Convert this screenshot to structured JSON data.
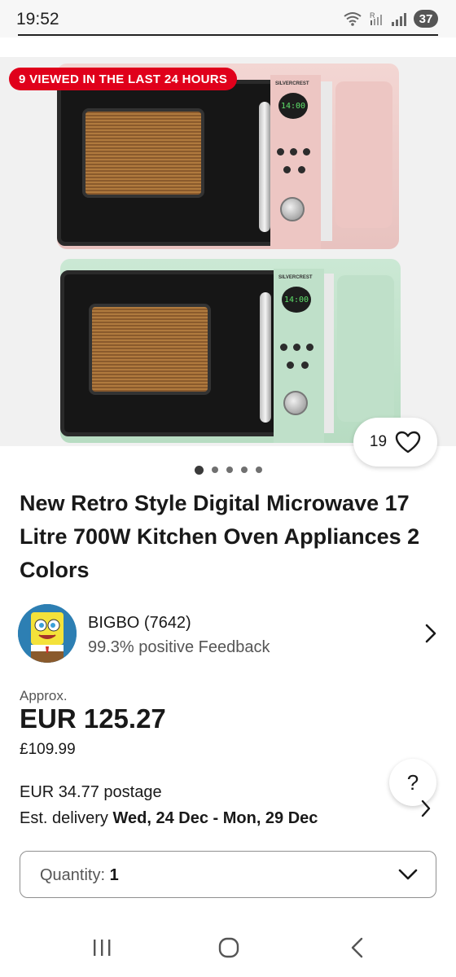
{
  "status_bar": {
    "time": "19:52",
    "battery": "37",
    "icons": [
      "wifi-icon",
      "roaming-signal-icon",
      "signal-icon",
      "battery-icon"
    ]
  },
  "gallery": {
    "viewed_badge": "9 VIEWED IN THE LAST 24 HOURS",
    "like_count": "19",
    "microwave_brand": "SILVERCREST",
    "display_time": "14:00",
    "image_count": 5,
    "active_index": 0
  },
  "listing": {
    "title": "New Retro Style Digital Microwave 17 Litre 700W Kitchen Oven Appliances 2 Colors"
  },
  "seller": {
    "name": "BIGBO (7642)",
    "feedback": "99.3% positive Feedback"
  },
  "price": {
    "approx_label": "Approx.",
    "amount": "EUR 125.27",
    "original": "£109.99"
  },
  "shipping": {
    "postage": "EUR 34.77 postage",
    "delivery_prefix": "Est. delivery ",
    "delivery_dates": "Wed, 24 Dec - Mon, 29 Dec"
  },
  "help_button": "?",
  "quantity": {
    "label": "Quantity:",
    "value": "1"
  },
  "colors": {
    "badge_red": "#e0001b",
    "text": "#191919",
    "muted": "#555555"
  }
}
